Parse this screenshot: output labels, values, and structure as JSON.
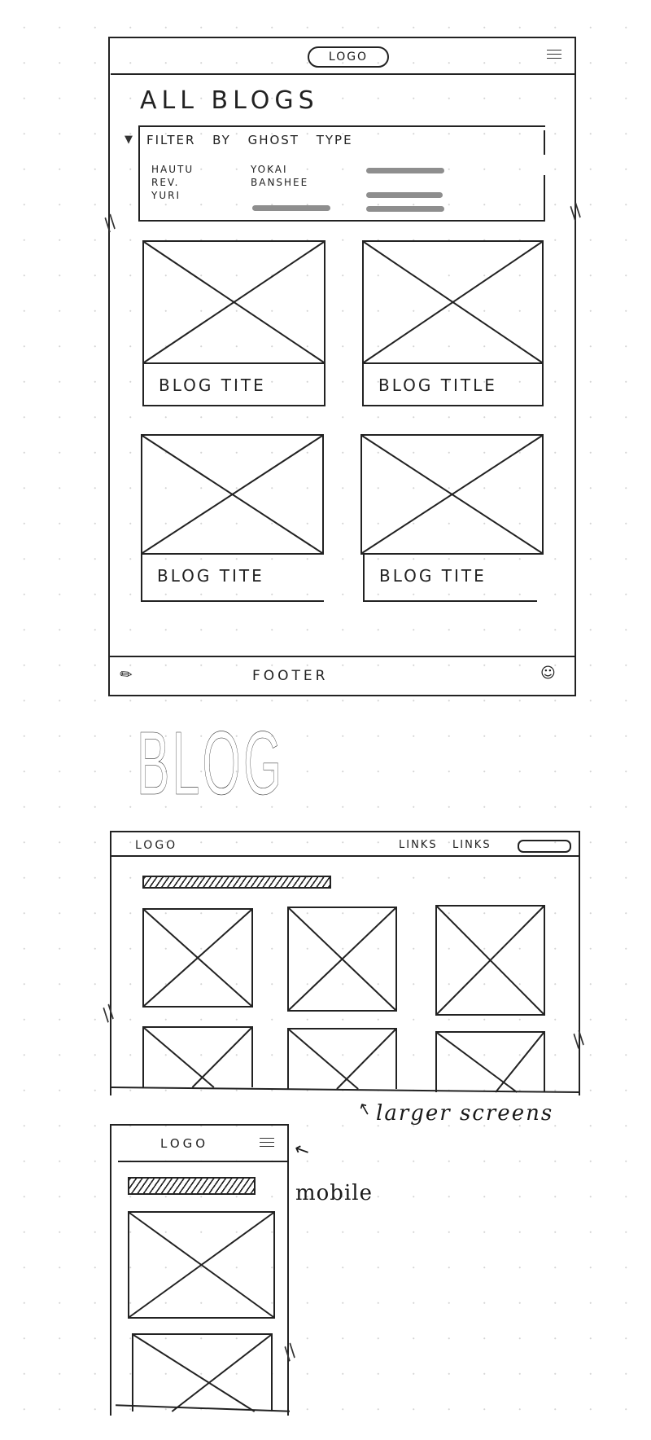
{
  "sketches": {
    "all_blogs_page": {
      "header": {
        "logo_label": "LOGO",
        "menu_icon": "hamburger-icon"
      },
      "page_title": "ALL BLOGS",
      "filter": {
        "icon": "funnel-icon",
        "heading": "FILTER BY GHOST TYPE",
        "options": [
          [
            "HAUTU",
            "YOKAI",
            "~"
          ],
          [
            "REV.",
            "BANSHEE",
            "~"
          ],
          [
            "YURI",
            "~",
            "~"
          ]
        ]
      },
      "cards": [
        {
          "title": "BLOG TITE"
        },
        {
          "title": "BLOG TITLE"
        },
        {
          "title": "BLOG TITE"
        },
        {
          "title": "BLOG TITE"
        }
      ],
      "footer": {
        "label": "FOOTER",
        "left_icon": "feather-icon",
        "right_icon": "skull-icon"
      }
    },
    "section_heading": "BLOG",
    "desktop_page": {
      "header": {
        "logo_label": "LOGO",
        "links": [
          "LINKS",
          "LINKS"
        ],
        "button_icon": "pill-button"
      },
      "annotation": "larger screens",
      "grid_columns": 3,
      "visible_cards": 6
    },
    "mobile_page": {
      "header": {
        "logo_label": "LOGO",
        "menu_icon": "hamburger-icon"
      },
      "annotation": "mobile",
      "visible_cards": 2
    }
  }
}
